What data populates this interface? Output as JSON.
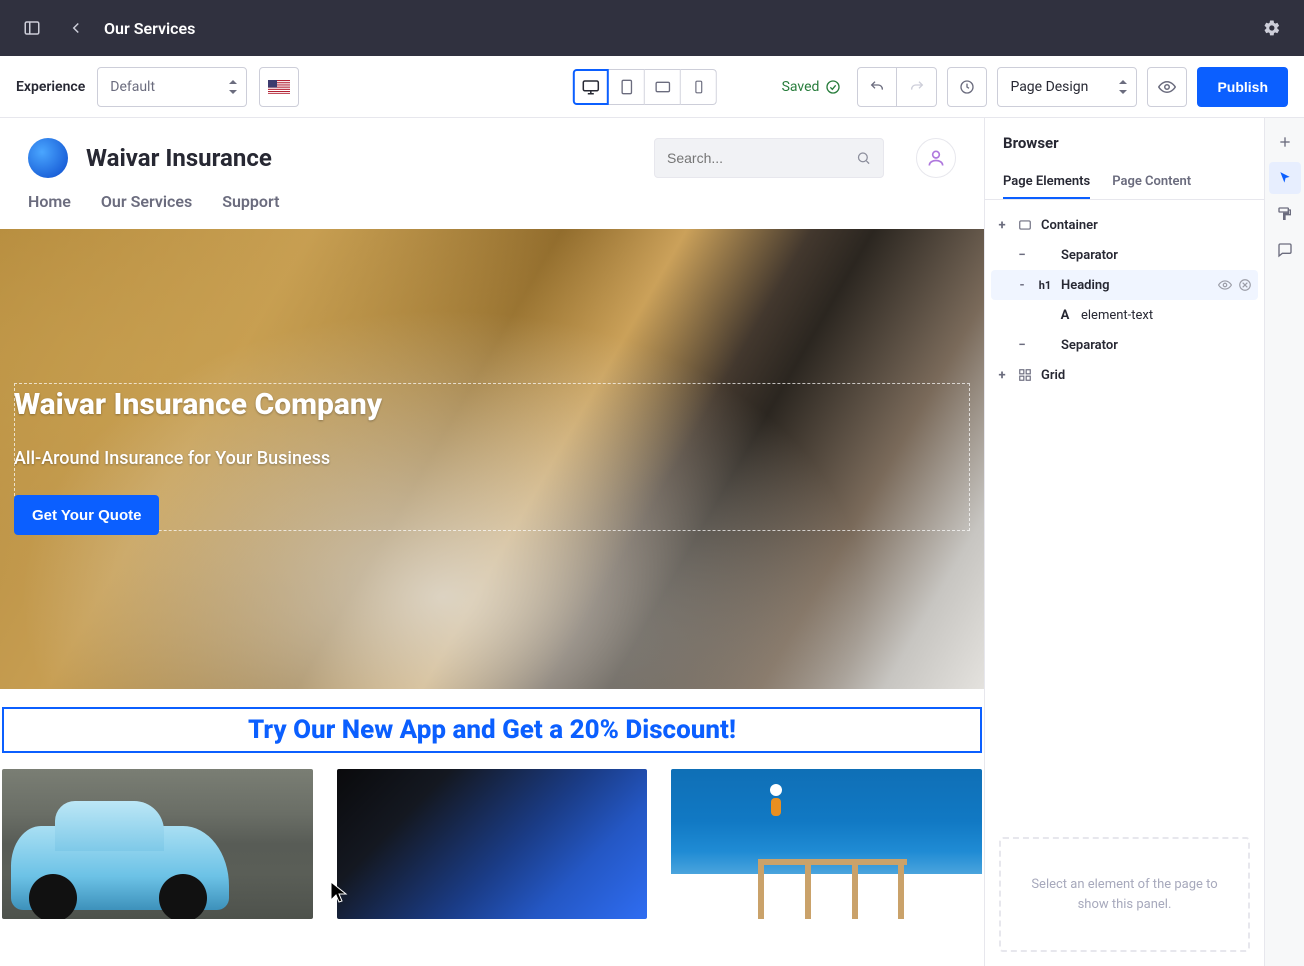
{
  "topbar": {
    "title": "Our Services"
  },
  "toolbar": {
    "experience_label": "Experience",
    "experience_value": "Default",
    "saved_label": "Saved",
    "page_mode": "Page Design",
    "publish_label": "Publish"
  },
  "site": {
    "name": "Waivar Insurance",
    "search_placeholder": "Search...",
    "nav": {
      "home": "Home",
      "services": "Our Services",
      "support": "Support"
    }
  },
  "hero": {
    "title": "Waivar Insurance Company",
    "subtitle": "All-Around Insurance for Your Business",
    "cta": "Get Your Quote"
  },
  "banner": {
    "text": "Try Our New App and Get a 20% Discount!"
  },
  "sidepanel": {
    "title": "Browser",
    "tabs": {
      "elements": "Page Elements",
      "content": "Page Content"
    },
    "tree": {
      "container": "Container",
      "separator": "Separator",
      "heading": "Heading",
      "element_text": "element-text",
      "grid": "Grid"
    },
    "placeholder": "Select an element of the page to show this panel."
  }
}
